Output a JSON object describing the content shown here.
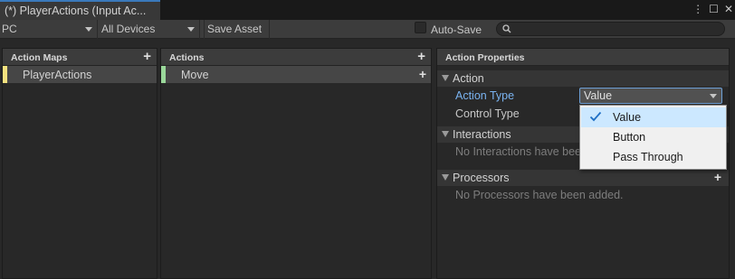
{
  "window": {
    "tab_title": "(*) PlayerActions (Input Ac...",
    "icons": [
      "more-vertical-icon",
      "maximize-icon",
      "close-icon"
    ]
  },
  "toolbar": {
    "control_scheme": "PC",
    "device": "All Devices",
    "save_label": "Save Asset",
    "auto_save_label": "Auto-Save",
    "auto_save_checked": false,
    "search_value": ""
  },
  "action_maps": {
    "header": "Action Maps",
    "items": [
      {
        "label": "PlayerActions",
        "color": "#f6e27f"
      }
    ]
  },
  "actions": {
    "header": "Actions",
    "items": [
      {
        "label": "Move",
        "color": "#9ad89a"
      }
    ]
  },
  "properties": {
    "header": "Action Properties",
    "action_section": "Action",
    "action_type_label": "Action Type",
    "action_type_value": "Value",
    "control_type_label": "Control Type",
    "interactions_section": "Interactions",
    "interactions_empty": "No Interactions have bee",
    "processors_section": "Processors",
    "processors_empty": "No Processors have been added."
  },
  "dropdown": {
    "options": [
      {
        "label": "Value",
        "selected": true
      },
      {
        "label": "Button",
        "selected": false
      },
      {
        "label": "Pass Through",
        "selected": false
      }
    ]
  },
  "colors": {
    "accent_tab": "#3a79bb",
    "label_blue": "#7ab3f0",
    "menu_highlight": "#cce8ff"
  }
}
